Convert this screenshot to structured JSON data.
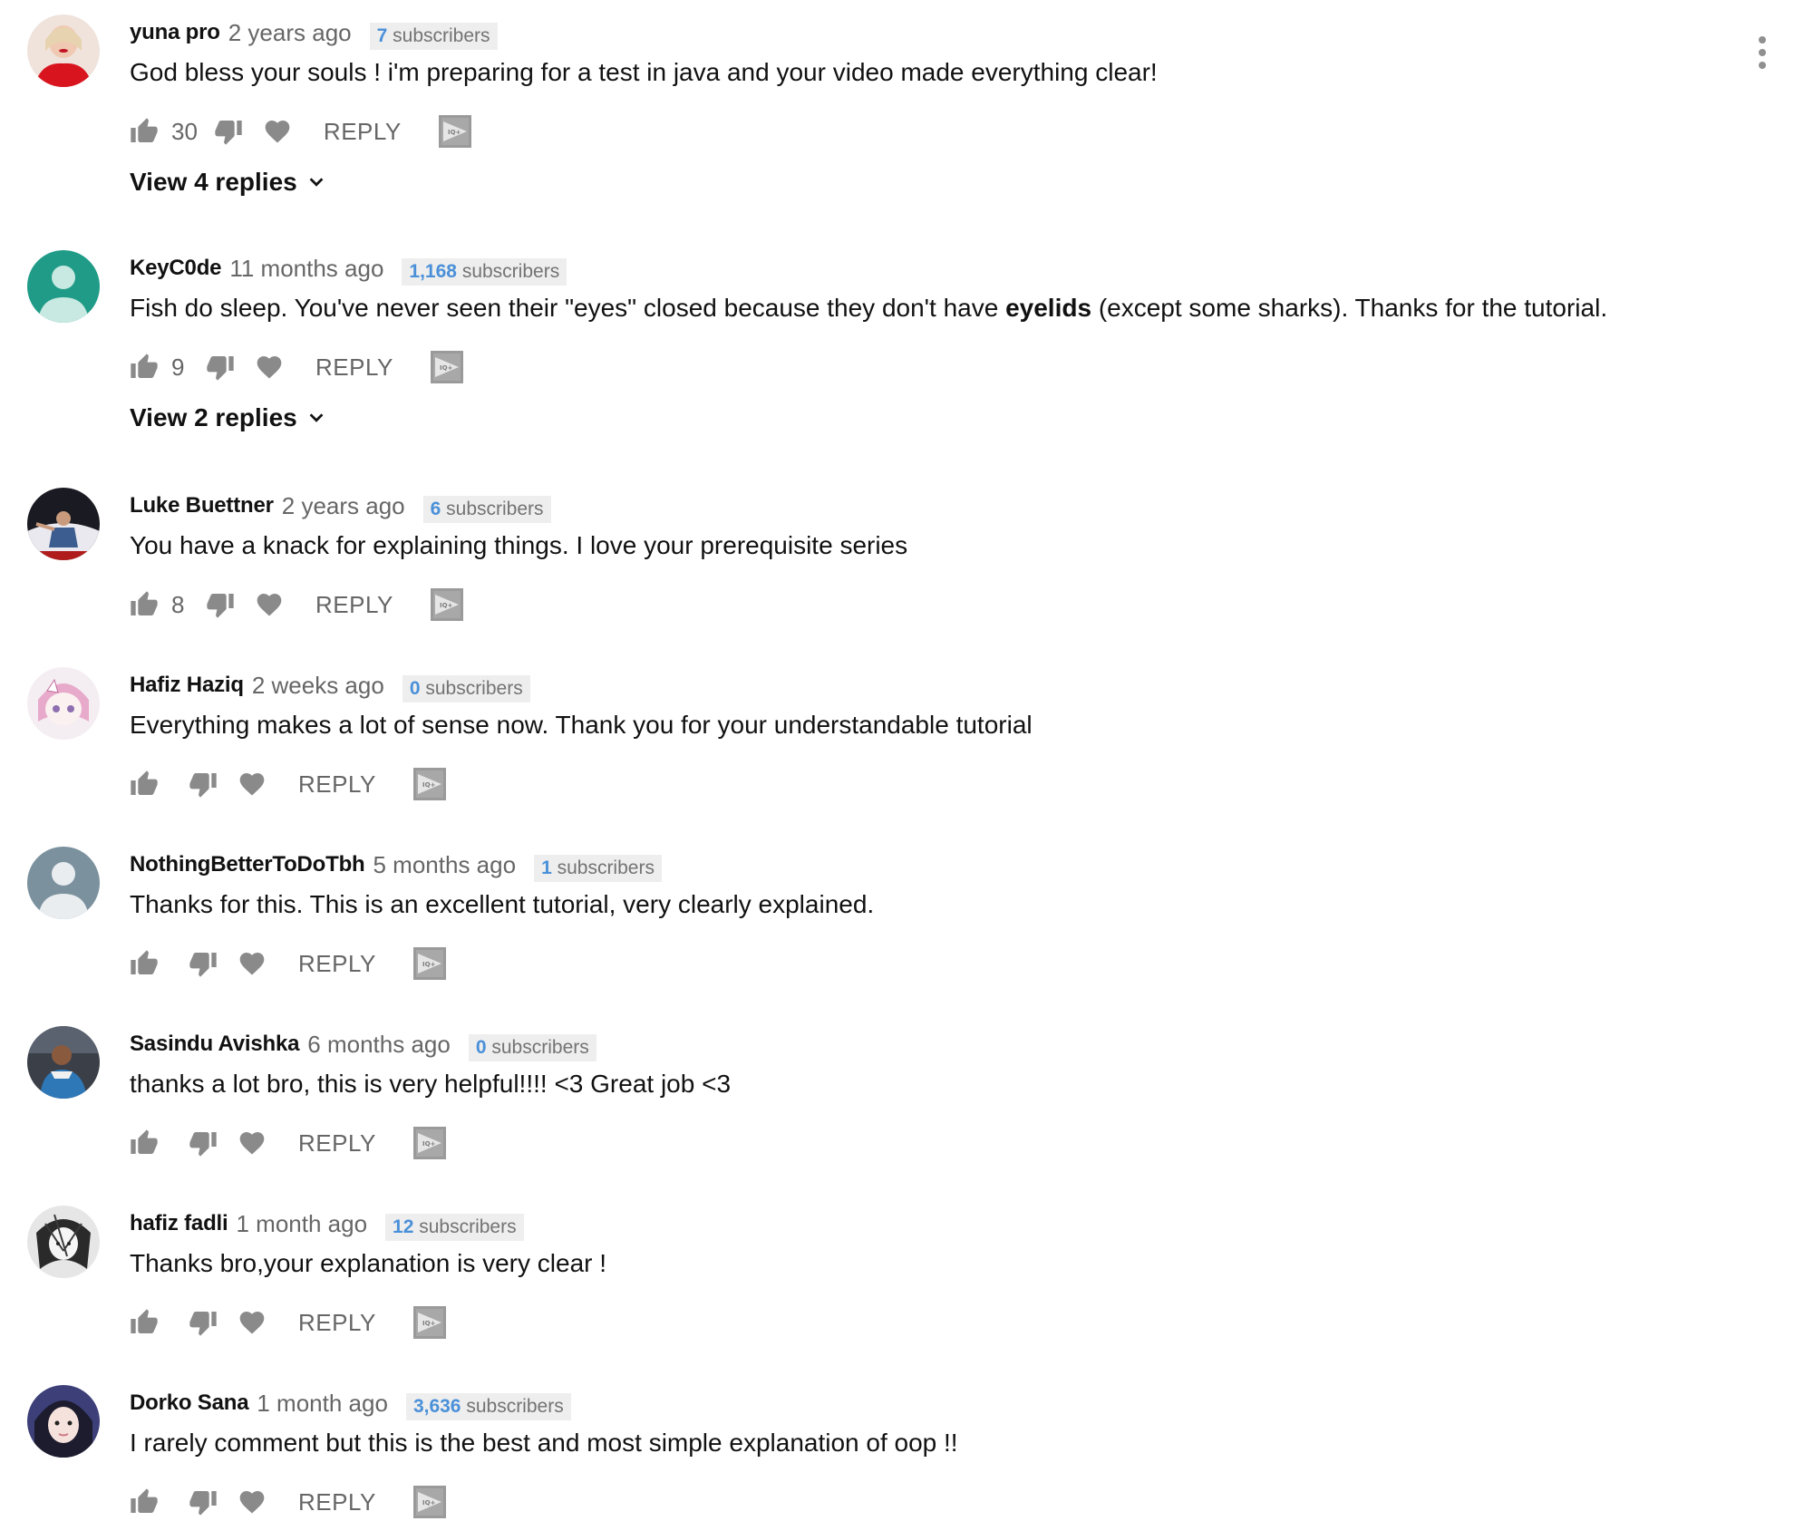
{
  "colors": {
    "author": "#111111",
    "meta": "#666666",
    "badge_bg": "#eeeeee",
    "badge_count": "#4a90d9",
    "icon": "#8a8a8a"
  },
  "icons": {
    "like": "thumbs-up-icon",
    "dislike": "thumbs-down-icon",
    "heart": "heart-icon",
    "iq": "iq-video-icon",
    "more": "more-vertical-icon",
    "chevron": "chevron-down-icon"
  },
  "comments": [
    {
      "author": "yuna pro",
      "time": "2 years ago",
      "subs_count": "7",
      "subs_label": " subscribers",
      "text_parts": [
        "God bless your souls ! i'm preparing for a test in java and your video made everything clear!"
      ],
      "likes": "30",
      "reply": "REPLY",
      "view_replies": "View 4 replies",
      "avatar": "photo-red"
    },
    {
      "author": "KeyC0de",
      "time": "11 months ago",
      "subs_count": "1,168",
      "subs_label": " subscribers",
      "text_before": "Fish do sleep. You've never seen their \"eyes\" closed because they don't have ",
      "text_bold": "eyelids",
      "text_after": " (except some sharks). Thanks for the tutorial.",
      "likes": "9",
      "reply": "REPLY",
      "view_replies": "View 2 replies",
      "avatar": "default-teal"
    },
    {
      "author": "Luke Buettner",
      "time": "2 years ago",
      "subs_count": "6",
      "subs_label": " subscribers",
      "text_parts": [
        "You have a knack for explaining things. I love your prerequisite series"
      ],
      "likes": "8",
      "reply": "REPLY",
      "avatar": "photo-dark"
    },
    {
      "author": "Hafiz Haziq",
      "time": "2 weeks ago",
      "subs_count": "0",
      "subs_label": " subscribers",
      "text_parts": [
        "Everything makes a lot of sense now. Thank you for your understandable tutorial"
      ],
      "likes": "",
      "reply": "REPLY",
      "avatar": "anime-pink"
    },
    {
      "author": "NothingBetterToDoTbh",
      "time": "5 months ago",
      "subs_count": "1",
      "subs_label": " subscribers",
      "text_parts": [
        "Thanks for this. This is an excellent tutorial, very clearly explained."
      ],
      "likes": "",
      "reply": "REPLY",
      "avatar": "default-gray"
    },
    {
      "author": "Sasindu Avishka",
      "time": "6 months ago",
      "subs_count": "0",
      "subs_label": " subscribers",
      "text_parts": [
        "thanks a lot bro, this is very helpful!!!! <3 Great job <3"
      ],
      "likes": "",
      "reply": "REPLY",
      "avatar": "photo-blue"
    },
    {
      "author": "hafiz fadli",
      "time": "1 month ago",
      "subs_count": "12",
      "subs_label": " subscribers",
      "text_parts": [
        "Thanks bro,your explanation is very clear !"
      ],
      "likes": "",
      "reply": "REPLY",
      "avatar": "manga-bw"
    },
    {
      "author": "Dorko Sana",
      "time": "1 month ago",
      "subs_count": "3,636",
      "subs_label": " subscribers",
      "text_parts": [
        "I rarely comment but this is the best and most simple explanation of oop !!"
      ],
      "likes": "",
      "reply": "REPLY",
      "avatar": "photo-portrait"
    }
  ]
}
